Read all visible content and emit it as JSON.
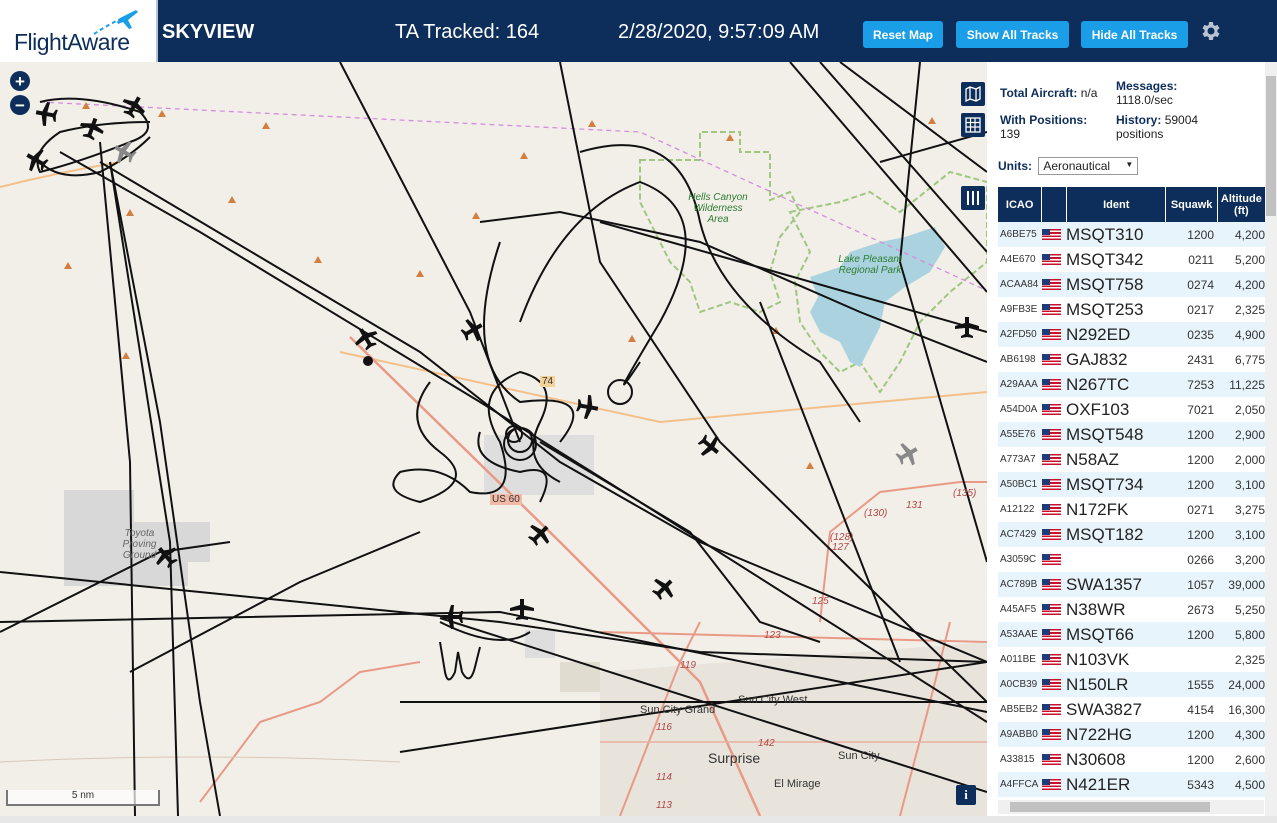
{
  "header": {
    "logo": "FlightAware",
    "title": "SKYVIEW",
    "tracked": "TA Tracked: 164",
    "datetime": "2/28/2020, 9:57:09 AM",
    "reset_label": "Reset Map",
    "show_label": "Show All Tracks",
    "hide_label": "Hide All Tracks",
    "settings_icon": "gear-icon"
  },
  "map": {
    "zoom_in": "+",
    "zoom_out": "−",
    "scale": "5 nm",
    "info": "i",
    "labels": {
      "hells_canyon": "Hells Canyon Wilderness Area",
      "lake_pleasant": "Lake Pleasant Regional Park",
      "toyota": "Toyota Proving Ground",
      "sun_city_grand": "Sun City Grand",
      "sun_city_west": "Sun City West",
      "surprise": "Surprise",
      "sun_city": "Sun City",
      "el_mirage": "El Mirage",
      "r74": "74",
      "us60": "US 60",
      "r130": "(130)",
      "r131": "131",
      "r135": "(135)",
      "r128": "(128)",
      "r127": "127",
      "r125": "125",
      "r123": "123",
      "r119": "119",
      "r116": "116",
      "r114": "114",
      "r113": "113",
      "r142": "142"
    },
    "colors": {
      "track": "#111111",
      "lake": "#aad3df",
      "park_border": "#9fc77f",
      "road": "#e89a86",
      "military": "#d8d8d8"
    }
  },
  "sidebar": {
    "total_label": "Total Aircraft:",
    "total_value": "n/a",
    "messages_label": "Messages:",
    "messages_value": "1118.0/sec",
    "positions_label": "With Positions:",
    "positions_value": "139",
    "history_label": "History:",
    "history_value": "59004",
    "history_unit": "positions",
    "units_label": "Units:",
    "units_value": "Aeronautical",
    "columns": [
      "ICAO",
      "",
      "Ident",
      "Squawk",
      "Altitude (ft)"
    ],
    "rows": [
      {
        "icao": "A6BE75",
        "ident": "MSQT310",
        "squawk": "1200",
        "alt": "4,200"
      },
      {
        "icao": "A4E670",
        "ident": "MSQT342",
        "squawk": "0211",
        "alt": "5,200"
      },
      {
        "icao": "ACAA84",
        "ident": "MSQT758",
        "squawk": "0274",
        "alt": "4,200"
      },
      {
        "icao": "A9FB3E",
        "ident": "MSQT253",
        "squawk": "0217",
        "alt": "2,325"
      },
      {
        "icao": "A2FD50",
        "ident": "N292ED",
        "squawk": "0235",
        "alt": "4,900"
      },
      {
        "icao": "AB6198",
        "ident": "GAJ832",
        "squawk": "2431",
        "alt": "6,775"
      },
      {
        "icao": "A29AAA",
        "ident": "N267TC",
        "squawk": "7253",
        "alt": "11,225"
      },
      {
        "icao": "A54D0A",
        "ident": "OXF103",
        "squawk": "7021",
        "alt": "2,050"
      },
      {
        "icao": "A55E76",
        "ident": "MSQT548",
        "squawk": "1200",
        "alt": "2,900"
      },
      {
        "icao": "A773A7",
        "ident": "N58AZ",
        "squawk": "1200",
        "alt": "2,000"
      },
      {
        "icao": "A50BC1",
        "ident": "MSQT734",
        "squawk": "1200",
        "alt": "3,100"
      },
      {
        "icao": "A12122",
        "ident": "N172FK",
        "squawk": "0271",
        "alt": "3,275"
      },
      {
        "icao": "AC7429",
        "ident": "MSQT182",
        "squawk": "1200",
        "alt": "3,100"
      },
      {
        "icao": "A3059C",
        "ident": "",
        "squawk": "0266",
        "alt": "3,200"
      },
      {
        "icao": "AC789B",
        "ident": "SWA1357",
        "squawk": "1057",
        "alt": "39,000"
      },
      {
        "icao": "A45AF5",
        "ident": "N38WR",
        "squawk": "2673",
        "alt": "5,250"
      },
      {
        "icao": "A53AAE",
        "ident": "MSQT66",
        "squawk": "1200",
        "alt": "5,800"
      },
      {
        "icao": "A011BE",
        "ident": "N103VK",
        "squawk": "",
        "alt": "2,325"
      },
      {
        "icao": "A0CB39",
        "ident": "N150LR",
        "squawk": "1555",
        "alt": "24,000"
      },
      {
        "icao": "AB5EB2",
        "ident": "SWA3827",
        "squawk": "4154",
        "alt": "16,300"
      },
      {
        "icao": "A9ABB0",
        "ident": "N722HG",
        "squawk": "1200",
        "alt": "4,300"
      },
      {
        "icao": "A33815",
        "ident": "N30608",
        "squawk": "1200",
        "alt": "2,600"
      },
      {
        "icao": "A4FFCA",
        "ident": "N421ER",
        "squawk": "5343",
        "alt": "4,500"
      }
    ]
  }
}
